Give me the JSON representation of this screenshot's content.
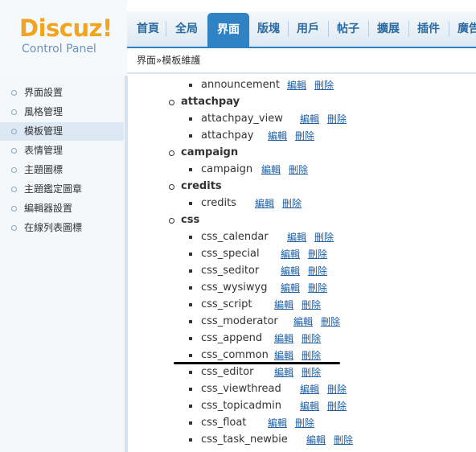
{
  "logo": {
    "brand": "Discuz!",
    "subtitle": "Control Panel"
  },
  "nav": {
    "items": [
      {
        "label": "首頁"
      },
      {
        "label": "全局"
      },
      {
        "label": "界面"
      },
      {
        "label": "版塊"
      },
      {
        "label": "用戶"
      },
      {
        "label": "帖子"
      },
      {
        "label": "擴展"
      },
      {
        "label": "插件"
      },
      {
        "label": "廣告"
      }
    ],
    "active": "界面"
  },
  "breadcrumb": "界面»模板維護",
  "sidebar": {
    "items": [
      {
        "label": "界面設置"
      },
      {
        "label": "風格管理"
      },
      {
        "label": "模板管理"
      },
      {
        "label": "表情管理"
      },
      {
        "label": "主題圖標"
      },
      {
        "label": "主題鑑定圖章"
      },
      {
        "label": "編輯器設置"
      },
      {
        "label": "在線列表圖標"
      }
    ],
    "active": "模板管理"
  },
  "actions": {
    "edit": "編輯",
    "delete": "刪除"
  },
  "templates": {
    "rows": [
      {
        "kind": "item",
        "name": "announcement"
      },
      {
        "kind": "group",
        "name": "attachpay"
      },
      {
        "kind": "item",
        "name": "attachpay_view"
      },
      {
        "kind": "item",
        "name": "attachpay"
      },
      {
        "kind": "group",
        "name": "campaign"
      },
      {
        "kind": "item",
        "name": "campaign"
      },
      {
        "kind": "group",
        "name": "credits"
      },
      {
        "kind": "item",
        "name": "credits"
      },
      {
        "kind": "group",
        "name": "css"
      },
      {
        "kind": "item",
        "name": "css_calendar"
      },
      {
        "kind": "item",
        "name": "css_special"
      },
      {
        "kind": "item",
        "name": "css_seditor"
      },
      {
        "kind": "item",
        "name": "css_wysiwyg"
      },
      {
        "kind": "item",
        "name": "css_script"
      },
      {
        "kind": "item",
        "name": "css_moderator"
      },
      {
        "kind": "item",
        "name": "css_append"
      },
      {
        "kind": "item",
        "name": "css_common"
      },
      {
        "kind": "item",
        "name": "css_editor"
      },
      {
        "kind": "item",
        "name": "css_viewthread"
      },
      {
        "kind": "item",
        "name": "css_topicadmin"
      },
      {
        "kind": "item",
        "name": "css_float"
      },
      {
        "kind": "item",
        "name": "css_task_newbie"
      }
    ]
  }
}
